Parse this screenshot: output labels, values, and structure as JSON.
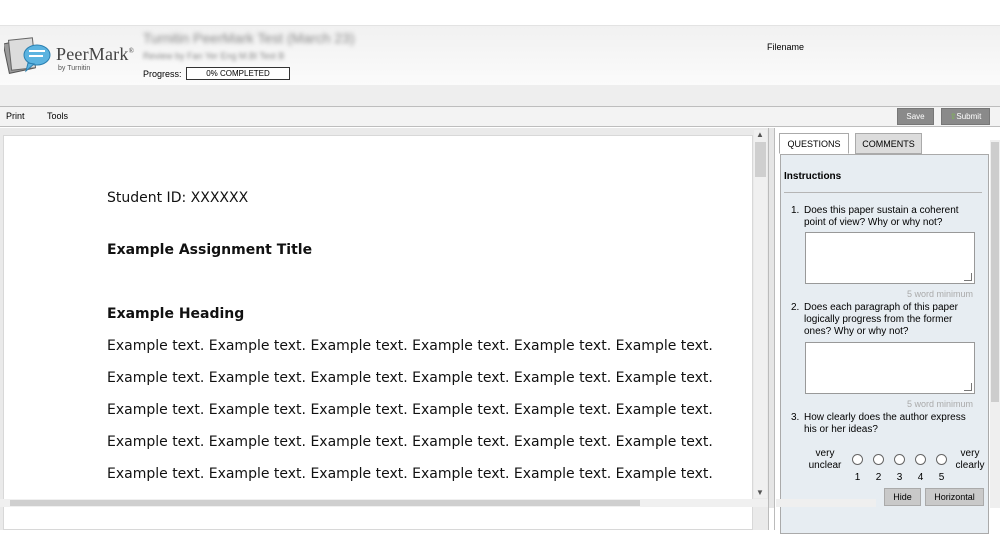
{
  "header": {
    "logo_name": "PeerMark",
    "logo_by": "by Turnitin",
    "assignment_title": "Turnitin PeerMark Test (March 23)",
    "assignment_subtitle": "Review by Fan Yer Eng M.Bl Test B",
    "progress_label": "Progress:",
    "progress_text": "0% COMPLETED",
    "progress_value": 0,
    "filename_label": "Filename"
  },
  "toolbar": {
    "print_label": "Print",
    "tools_label": "Tools",
    "save_label": "Save",
    "submit_label": "Submit",
    "submit_icon": "up-arrow-icon"
  },
  "document": {
    "student_id": "Student ID: XXXXXX",
    "assignment_title": "Example Assignment Title",
    "heading": "Example Heading",
    "lines": [
      "Example text. Example text. Example text. Example text. Example text. Example text.",
      "Example text. Example text. Example text. Example text. Example text. Example text.",
      "Example text. Example text. Example text. Example text. Example text. Example text.",
      "Example text. Example text. Example text. Example text. Example text. Example text.",
      "Example text. Example text. Example text. Example text. Example text. Example text."
    ]
  },
  "panel": {
    "tabs": [
      {
        "label": "QUESTIONS"
      },
      {
        "label": "COMMENTS"
      }
    ],
    "instructions_label": "Instructions",
    "questions": [
      {
        "number": "1.",
        "text": "Does this paper sustain a coherent point of view? Why or why not?",
        "min_words": "5 word minimum"
      },
      {
        "number": "2.",
        "text": "Does each paragraph of this paper logically progress from the former ones? Why or why not?",
        "min_words": "5 word minimum"
      },
      {
        "number": "3.",
        "text": "How clearly does the author express his or her ideas?",
        "scale_low": "very unclear",
        "scale_high": "very clearly",
        "scale_options": [
          "1",
          "2",
          "3",
          "4",
          "5"
        ]
      }
    ],
    "hide_label": "Hide",
    "horizontal_label": "Horizontal"
  },
  "colors": {
    "button_gray": "#8a8a8a",
    "panel_bg": "#e7edf2",
    "submit_arrow": "#7cc04b"
  }
}
